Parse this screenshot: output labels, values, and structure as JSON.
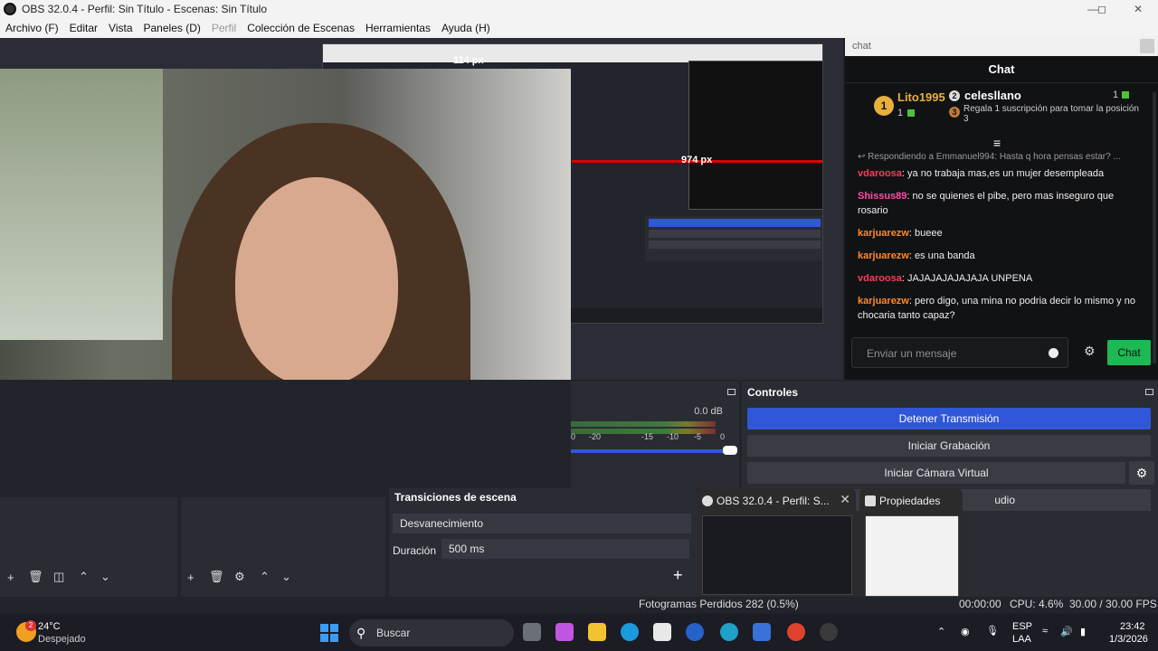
{
  "window": {
    "title": "OBS 32.0.4 - Perfil: Sin Título - Escenas: Sin Título"
  },
  "menu": [
    "Archivo (F)",
    "Editar",
    "Vista",
    "Paneles (D)",
    "Perfil",
    "Colección de Escenas",
    "Herramientas",
    "Ayuda (H)"
  ],
  "preview": {
    "measure_top": "114 px",
    "measure_right": "974 px"
  },
  "chat": {
    "header": "chat",
    "title": "Chat",
    "leader_first": {
      "rank": "1",
      "name": "Lito1995",
      "count": "1"
    },
    "leader_second": {
      "rank": "2",
      "name": "celesllano",
      "count": "1"
    },
    "leader_third": {
      "rank": "3",
      "hint": "Regala 1 suscripción para tomar la posición 3"
    },
    "reply_to": "Respondiendo a Emmanuel994: Hasta q hora pensas estar? ...",
    "messages": [
      {
        "user": "vdaroosa",
        "color": "#ff3a5a",
        "text": ": ya no trabaja mas,es un mujer desempleada"
      },
      {
        "user": "Shissus89",
        "color": "#ff4fa6",
        "text": ": no se quienes el pibe, pero mas inseguro que rosario"
      },
      {
        "user": "karjuarezw",
        "color": "#ff8a2a",
        "text": ": bueee"
      },
      {
        "user": "karjuarezw",
        "color": "#ff8a2a",
        "text": ": es una banda"
      },
      {
        "user": "vdaroosa",
        "color": "#ff3a5a",
        "text": ": JAJAJAJAJAJAJA UNPENA"
      },
      {
        "user": "karjuarezw",
        "color": "#ff8a2a",
        "text": ": pero digo, una mina no podria decir lo mismo y no chocaria tanto capaz?"
      }
    ],
    "input_placeholder": "Enviar un mensaje",
    "send_label": "Chat"
  },
  "mixer": {
    "db": "0.0 dB",
    "scale": [
      "0",
      "-20",
      "-15",
      "-10",
      "-5",
      "0"
    ]
  },
  "controls": {
    "title": "Controles",
    "stop_stream": "Detener Transmisión",
    "start_recording": "Iniciar Grabación",
    "start_virtual_cam": "Iniciar Cámara Virtual",
    "partial": "udio"
  },
  "transitions": {
    "title": "Transiciones de escena",
    "selected": "Desvanecimiento",
    "duration_label": "Duración",
    "duration_value": "500 ms"
  },
  "thumbs": {
    "obs": "OBS 32.0.4 - Perfil: S...",
    "props": "Propiedades"
  },
  "status": {
    "frames": "Fotogramas Perdidos 282 (0.5%)",
    "time": "00:00:00",
    "cpu": "CPU: 4.6%",
    "fps": "30.00 / 30.00 FPS"
  },
  "taskbar": {
    "weather_badge": "2",
    "temp": "24°C",
    "condition": "Despejado",
    "search": "Buscar",
    "lang1": "ESP",
    "lang2": "LAA",
    "time": "23:42",
    "date": "1/3/2026"
  },
  "colors": {
    "accent": "#2f57d8",
    "chat_send": "#1db954",
    "gold": "#e8b03a"
  }
}
